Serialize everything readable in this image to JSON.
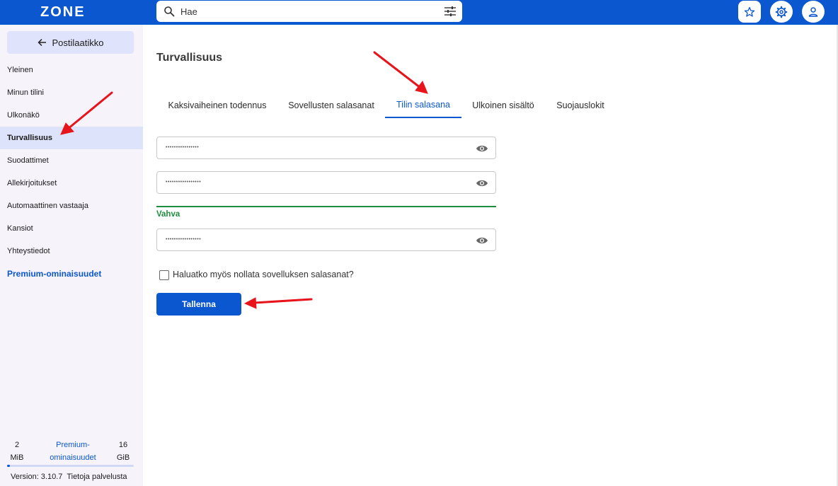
{
  "app": {
    "logo_text": "ZONE"
  },
  "search": {
    "placeholder": "Hae"
  },
  "sidebar": {
    "back_label": "Postilaatikko",
    "items": [
      {
        "label": "Yleinen"
      },
      {
        "label": "Minun tilini"
      },
      {
        "label": "Ulkonäkö"
      },
      {
        "label": "Turvallisuus",
        "active": true
      },
      {
        "label": "Suodattimet"
      },
      {
        "label": "Allekirjoitukset"
      },
      {
        "label": "Automaattinen vastaaja"
      },
      {
        "label": "Kansiot"
      },
      {
        "label": "Yhteystiedot"
      }
    ],
    "premium_label": "Premium-ominaisuudet",
    "quota": {
      "used_value": "2",
      "used_unit": "MiB",
      "middle_line1": "Premium-",
      "middle_line2": "ominaisuudet",
      "total_value": "16",
      "total_unit": "GiB",
      "fill_percent": 2
    },
    "version": "Version: 3.10.7",
    "about_link": "Tietoja palvelusta"
  },
  "main": {
    "title": "Turvallisuus",
    "tabs": [
      {
        "label": "Kaksivaiheinen todennus"
      },
      {
        "label": "Sovellusten salasanat"
      },
      {
        "label": "Tilin salasana",
        "active": true
      },
      {
        "label": "Ulkoinen sisältö"
      },
      {
        "label": "Suojauslokit"
      }
    ],
    "password_fields": [
      {
        "masked_value": "••••••••••••••••"
      },
      {
        "masked_value": "•••••••••••••••••"
      },
      {
        "masked_value": "•••••••••••••••••"
      }
    ],
    "strength_label": "Vahva",
    "reset_checkbox_label": "Haluatko myös nollata sovelluksen salasanat?",
    "reset_checked": false,
    "save_label": "Tallenna"
  },
  "colors": {
    "primary": "#0b57d0",
    "sidebar_bg": "#f6f3fb",
    "active_item_bg": "#dde3fa",
    "strength_green": "#1e8e3e",
    "annotation_red": "#e8141b"
  }
}
